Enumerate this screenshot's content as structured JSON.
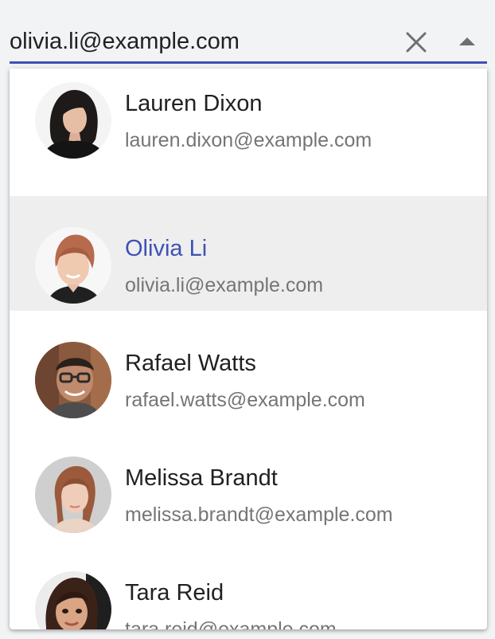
{
  "combobox": {
    "value": "olivia.li@example.com",
    "accent_color": "#3f51b5",
    "clear_icon": "close-icon",
    "toggle_icon": "arrow-drop-up-icon"
  },
  "options": [
    {
      "name": "Lauren Dixon",
      "email": "lauren.dixon@example.com",
      "avatar": "avatar-photo",
      "highlighted": false
    },
    {
      "name": "Olivia Li",
      "email": "olivia.li@example.com",
      "avatar": "avatar-photo",
      "highlighted": true
    },
    {
      "name": "Rafael Watts",
      "email": "rafael.watts@example.com",
      "avatar": "avatar-photo",
      "highlighted": false
    },
    {
      "name": "Melissa Brandt",
      "email": "melissa.brandt@example.com",
      "avatar": "avatar-photo",
      "highlighted": false
    },
    {
      "name": "Tara Reid",
      "email": "tara.reid@example.com",
      "avatar": "avatar-photo",
      "highlighted": false
    }
  ]
}
